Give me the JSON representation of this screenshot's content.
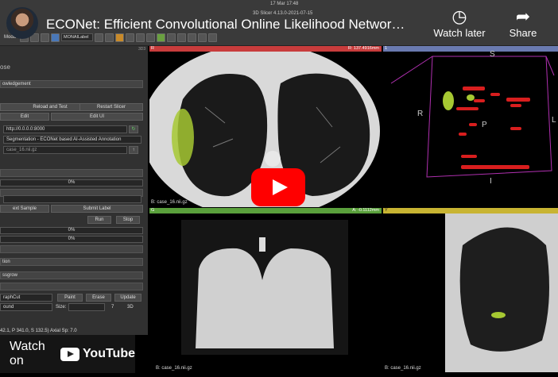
{
  "slicer": {
    "clock": "17 Mar  17:48",
    "app_title": "3D Slicer 4.13.0-2021-07-15",
    "modules_label": "Modu",
    "module_select": "MONAILabel"
  },
  "youtube": {
    "title": "ECONet: Efficient Convolutional Online Likelihood Networ…",
    "watch_later": "Watch later",
    "share": "Share",
    "watch_on": "Watch on",
    "logo_text": "YouTube"
  },
  "panel": {
    "logo": "ose",
    "number": "3D3",
    "acknowledgement": "owledgement",
    "reload_test": "Reload and Test",
    "restart": "Restart Slicer",
    "edit": "Edit",
    "edit_ui": "Edit UI",
    "server_url": "http://0.0.0.0:8000",
    "app_select": "Segmentation - ECONet based AI-Assisted Annotation",
    "volume": "case_16.nii.gz",
    "progress_1": "0%",
    "next_sample": "ext Sample",
    "submit_label": "Submit Label",
    "run": "Run",
    "stop": "Stop",
    "progress_2": "0%",
    "progress_3": "0%",
    "section_a": "tion",
    "section_b": "ssgrow",
    "tool": "raphCut",
    "paint": "Paint",
    "erase": "Erase",
    "update": "Update",
    "scope": "ound",
    "size_label": "Size:",
    "size_value": "7",
    "three_d": "3D",
    "coords": "42.1, P 341.0, S 132.5)      Axial Sp: 7.0"
  },
  "views": {
    "red": {
      "letter": "R",
      "value": "R: 137.4916mm",
      "file": "B: case_16.nii.gz"
    },
    "three_d": {
      "letter": "1",
      "labels": {
        "superior": "S",
        "right": "R",
        "posterior": "P",
        "left": "L",
        "inferior": "I"
      }
    },
    "green": {
      "letter": "G",
      "value": "A: -0.1112mm",
      "file": "B: case_16.nii.gz"
    },
    "yellow": {
      "letter": "Y",
      "file": "B: case_16.nii.gz"
    }
  },
  "colors": {
    "red_bar": "#c83c3c",
    "green_bar": "#5aa03c",
    "yellow_bar": "#c8b432",
    "view_3d_bg": "#7c6a9e",
    "annotation": "#a6c832",
    "vessel": "#d81e1e"
  }
}
